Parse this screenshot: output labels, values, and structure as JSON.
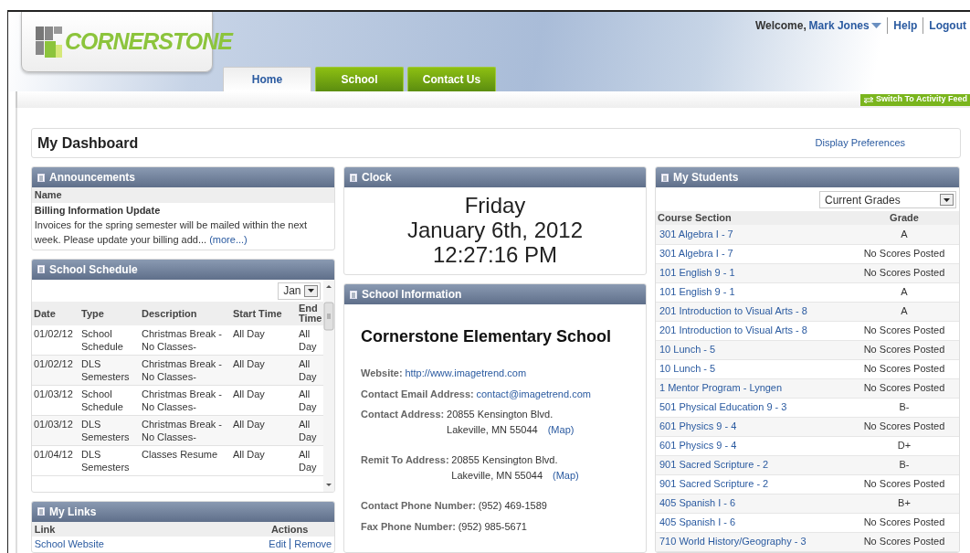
{
  "header": {
    "logo": "CORNERSTONE",
    "welcome": "Welcome,",
    "user": "Mark Jones",
    "links": [
      "Help",
      "Logout"
    ]
  },
  "tabs": [
    {
      "label": "Home",
      "selected": true
    },
    {
      "label": "School",
      "selected": false
    },
    {
      "label": "Contact Us",
      "selected": false
    }
  ],
  "switch_button": "Switch To Activity Feed",
  "dashboard": {
    "title": "My Dashboard",
    "preferences": "Display Preferences"
  },
  "announcements": {
    "title": "Announcements",
    "column": "Name",
    "items": [
      {
        "title": "Billing Information Update",
        "body": "Invoices for the spring semester will be mailed within the next week. Please update your billing add...",
        "more": "(more...)"
      }
    ]
  },
  "schedule": {
    "title": "School Schedule",
    "month": "Jan",
    "columns": [
      "Date",
      "Type",
      "Description",
      "Start Time",
      "End Time"
    ],
    "rows": [
      {
        "date": "01/02/12",
        "type": "School Schedule",
        "description": "Christmas Break - No Classes-",
        "start": "All Day",
        "end": "All Day"
      },
      {
        "date": "01/02/12",
        "type": "DLS Semesters",
        "description": "Christmas Break - No Classes-",
        "start": "All Day",
        "end": "All Day"
      },
      {
        "date": "01/03/12",
        "type": "School Schedule",
        "description": "Christmas Break - No Classes-",
        "start": "All Day",
        "end": "All Day"
      },
      {
        "date": "01/03/12",
        "type": "DLS Semesters",
        "description": "Christmas Break - No Classes-",
        "start": "All Day",
        "end": "All Day"
      },
      {
        "date": "01/04/12",
        "type": "DLS Semesters",
        "description": "Classes Resume",
        "start": "All Day",
        "end": "All Day"
      }
    ]
  },
  "my_links": {
    "title": "My Links",
    "columns": [
      "Link",
      "Actions"
    ],
    "rows": [
      {
        "link": "School Website",
        "actions": [
          "Edit",
          "Remove"
        ]
      }
    ]
  },
  "clock": {
    "title": "Clock",
    "day": "Friday",
    "date": "January 6th, 2012",
    "time": "12:27:16 PM"
  },
  "school_info": {
    "title": "School Information",
    "name": "Cornerstone Elementary School",
    "fields": [
      {
        "kind": "link",
        "label": "Website:",
        "value": "http://www.imagetrend.com"
      },
      {
        "kind": "link",
        "label": "Contact Email Address:",
        "value": "contact@imagetrend.com"
      },
      {
        "kind": "address",
        "label": "Contact Address:",
        "lines": [
          "20855 Kensington Blvd.",
          "Lakeville, MN 55044"
        ],
        "map": "(Map)"
      },
      {
        "kind": "address",
        "label": "Remit To Address:",
        "lines": [
          "20855 Kensington Blvd.",
          "Lakeville, MN 55044"
        ],
        "map": "(Map)"
      },
      {
        "kind": "text",
        "label": "Contact Phone Number:",
        "value": "(952) 469-1589"
      },
      {
        "kind": "text",
        "label": "Fax Phone Number:",
        "value": "(952) 985-5671"
      }
    ]
  },
  "students": {
    "title": "My Students",
    "filter": "Current Grades",
    "columns": [
      "Course Section",
      "Grade"
    ],
    "rows": [
      {
        "course": "301 Algebra I - 7",
        "grade": "A"
      },
      {
        "course": "301 Algebra I - 7",
        "grade": "No Scores Posted"
      },
      {
        "course": "101 English 9 - 1",
        "grade": "No Scores Posted"
      },
      {
        "course": "101 English 9 - 1",
        "grade": "A"
      },
      {
        "course": "201 Introduction to Visual Arts - 8",
        "grade": "A"
      },
      {
        "course": "201 Introduction to Visual Arts - 8",
        "grade": "No Scores Posted"
      },
      {
        "course": "10 Lunch - 5",
        "grade": "No Scores Posted"
      },
      {
        "course": "10 Lunch - 5",
        "grade": "No Scores Posted"
      },
      {
        "course": "1 Mentor Program - Lyngen",
        "grade": "No Scores Posted"
      },
      {
        "course": "501 Physical Education 9 - 3",
        "grade": "B-"
      },
      {
        "course": "601 Physics 9 - 4",
        "grade": "No Scores Posted"
      },
      {
        "course": "601 Physics 9 - 4",
        "grade": "D+"
      },
      {
        "course": "901 Sacred Scripture - 2",
        "grade": "B-"
      },
      {
        "course": "901 Sacred Scripture - 2",
        "grade": "No Scores Posted"
      },
      {
        "course": "405 Spanish I - 6",
        "grade": "B+"
      },
      {
        "course": "405 Spanish I - 6",
        "grade": "No Scores Posted"
      },
      {
        "course": "710 World History/Geography - 3",
        "grade": "No Scores Posted"
      }
    ]
  }
}
